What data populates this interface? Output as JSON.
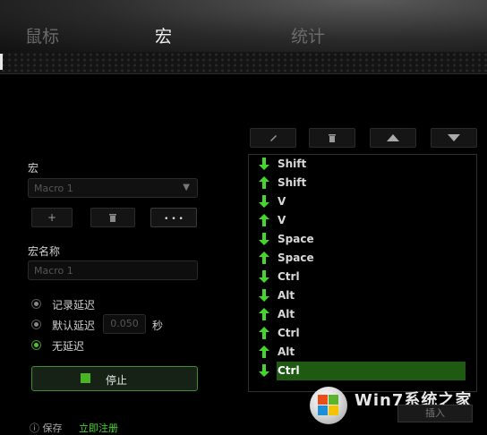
{
  "tabs": [
    {
      "label": "鼠标",
      "active": false
    },
    {
      "label": "宏",
      "active": true
    },
    {
      "label": "统计",
      "active": false
    }
  ],
  "macro_section": {
    "label": "宏",
    "selected_macro": "Macro 1",
    "add_button": "+",
    "delete_button": "trash-icon",
    "more_button": "• • •"
  },
  "name_section": {
    "label": "宏名称",
    "value": "Macro 1"
  },
  "delay_options": {
    "record_delay": "记录延迟",
    "default_delay": "默认延迟",
    "default_delay_value": "0.050",
    "seconds_unit": "秒",
    "no_delay": "无延迟",
    "selected": "无延迟"
  },
  "stop_button": "停止",
  "toolbar": {
    "edit": "pencil-icon",
    "delete": "trash-icon",
    "move_up": "triangle-up-icon",
    "move_down": "triangle-down-icon"
  },
  "events": [
    {
      "dir": "down",
      "key": "Shift"
    },
    {
      "dir": "up",
      "key": "Shift"
    },
    {
      "dir": "down",
      "key": "V"
    },
    {
      "dir": "up",
      "key": "V"
    },
    {
      "dir": "down",
      "key": "Space"
    },
    {
      "dir": "up",
      "key": "Space"
    },
    {
      "dir": "down",
      "key": "Ctrl"
    },
    {
      "dir": "down",
      "key": "Alt"
    },
    {
      "dir": "up",
      "key": "Alt"
    },
    {
      "dir": "up",
      "key": "Ctrl"
    },
    {
      "dir": "up",
      "key": "Alt"
    },
    {
      "dir": "down",
      "key": "Ctrl",
      "selected": true
    }
  ],
  "footer": {
    "save": "保存",
    "link": "立即注册"
  },
  "watermark": {
    "brand": "Win7系统之家",
    "insert_label": "插入"
  },
  "colors": {
    "accent_green": "#44d62c",
    "selection_green": "#1e5a12",
    "background": "#000000"
  }
}
